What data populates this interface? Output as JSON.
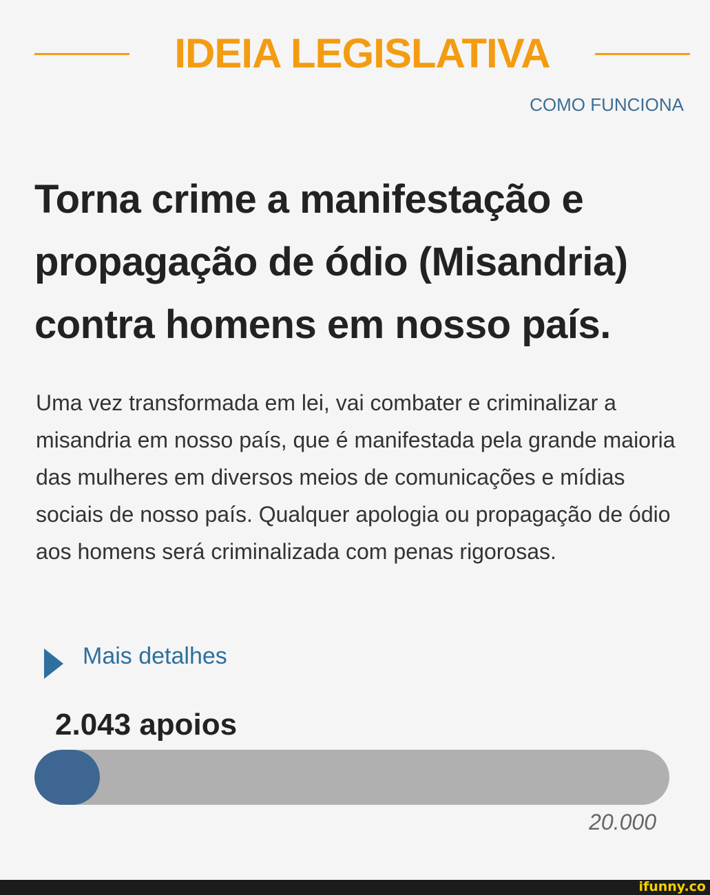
{
  "header": {
    "title": "IDEIA LEGISLATIVA",
    "how_it_works_link": "COMO FUNCIONA"
  },
  "idea": {
    "title": "Torna crime a manifestação e propagação de ódio (Misandria) contra homens em nosso país.",
    "description": "Uma vez transformada em lei, vai combater e criminalizar a misandria em nosso país, que é manifestada pela grande maioria das mulheres em diversos meios de comunicações e mídias sociais de nosso país. Qualquer apologia ou propagação de ódio aos homens será criminalizada com penas rigorosas.",
    "details_toggle": "Mais detalhes"
  },
  "support": {
    "count_label": "2.043 apoios",
    "count": 2043,
    "goal_label": "20.000",
    "goal": 20000
  },
  "watermark": "ifunny.co",
  "icons": {
    "details": "caret-right-icon"
  },
  "colors": {
    "accent": "#f39c12",
    "link": "#2e6f9e",
    "progress_fill": "#3d6792",
    "progress_track": "#b0b0b0"
  }
}
